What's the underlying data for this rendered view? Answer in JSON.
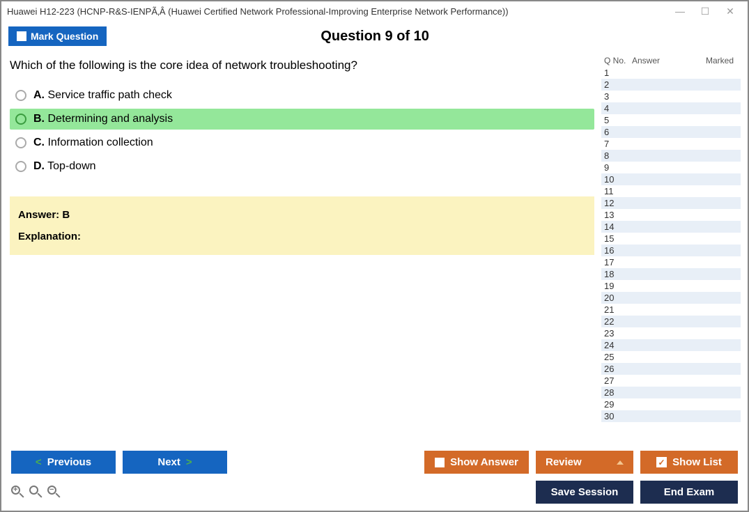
{
  "window": {
    "title": "Huawei H12-223 (HCNP-R&S-IENPÃ‚Â (Huawei Certified Network Professional-Improving Enterprise Network Performance))"
  },
  "header": {
    "mark_label": "Mark Question",
    "question_title": "Question 9 of 10"
  },
  "question": {
    "text": "Which of the following is the core idea of network troubleshooting?",
    "options": {
      "A": {
        "letter": "A.",
        "text": " Service traffic path check"
      },
      "B": {
        "letter": "B.",
        "text": " Determining and analysis"
      },
      "C": {
        "letter": "C.",
        "text": " Information collection"
      },
      "D": {
        "letter": "D.",
        "text": " Top-down"
      }
    },
    "answer_label": "Answer: B",
    "explanation_label": "Explanation:"
  },
  "qlist": {
    "headers": {
      "qno": "Q No.",
      "answer": "Answer",
      "marked": "Marked"
    },
    "rows": [
      "1",
      "2",
      "3",
      "4",
      "5",
      "6",
      "7",
      "8",
      "9",
      "10",
      "11",
      "12",
      "13",
      "14",
      "15",
      "16",
      "17",
      "18",
      "19",
      "20",
      "21",
      "22",
      "23",
      "24",
      "25",
      "26",
      "27",
      "28",
      "29",
      "30"
    ]
  },
  "footer": {
    "previous": "Previous",
    "next": "Next",
    "show_answer": "Show Answer",
    "review": "Review",
    "show_list": "Show List",
    "save_session": "Save Session",
    "end_exam": "End Exam"
  }
}
